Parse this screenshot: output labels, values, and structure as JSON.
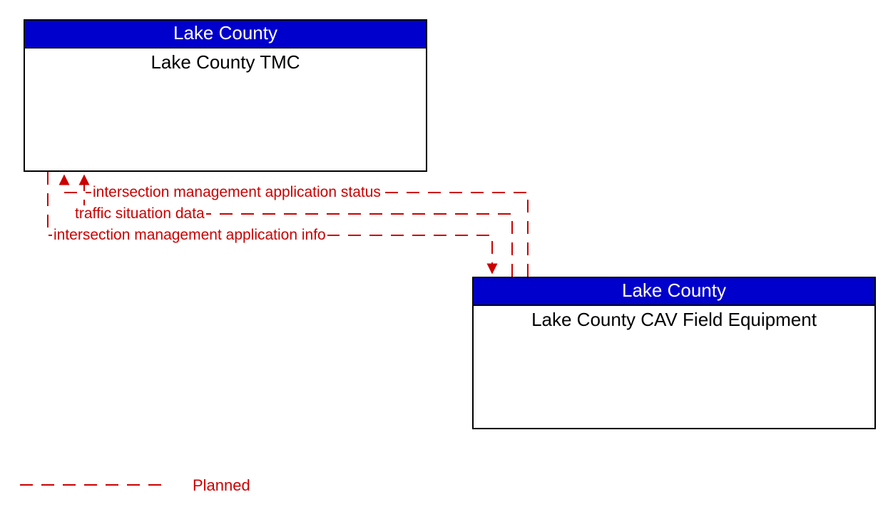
{
  "nodes": {
    "tmc": {
      "header": "Lake County",
      "title": "Lake County TMC"
    },
    "cav": {
      "header": "Lake County",
      "title": "Lake County CAV Field Equipment"
    }
  },
  "flows": {
    "status": "intersection management application status",
    "traffic": "traffic situation data",
    "info": "intersection management application info"
  },
  "legend": {
    "planned": "Planned"
  },
  "colors": {
    "planned": "#cc0000",
    "header_bg": "#0000cc"
  }
}
